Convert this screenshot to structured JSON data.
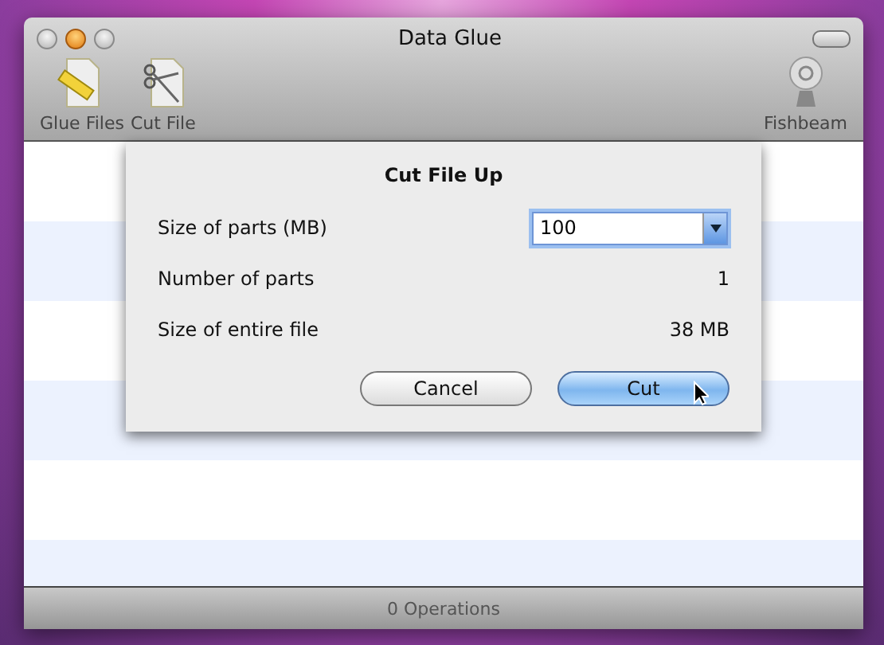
{
  "window": {
    "title": "Data Glue"
  },
  "toolbar": {
    "items": [
      {
        "label": "Glue Files",
        "kind": "glue"
      },
      {
        "label": "Cut File",
        "kind": "cut"
      }
    ],
    "right_item": {
      "label": "Fishbeam"
    }
  },
  "sheet": {
    "title": "Cut File Up",
    "size_field": {
      "label": "Size of parts (MB)",
      "value": "100"
    },
    "rows": [
      {
        "label": "Number of parts",
        "value": "1"
      },
      {
        "label": "Size of entire file",
        "value": "38 MB"
      }
    ],
    "buttons": [
      {
        "label": "Cancel",
        "default": false
      },
      {
        "label": "Cut",
        "default": true
      }
    ]
  },
  "status_bar": "0 Operations"
}
